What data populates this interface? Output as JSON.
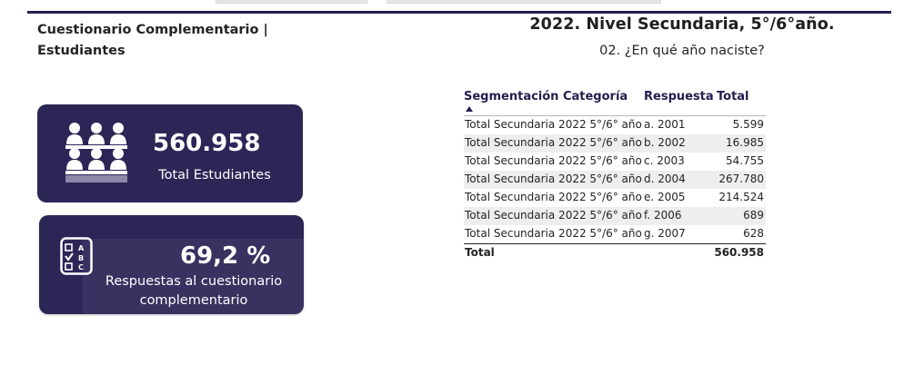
{
  "header": {
    "page_title": "Cuestionario Complementario | Estudiantes",
    "report_title": "2022. Nivel Secundaria, 5°/6°año.",
    "question": "02. ¿En qué año naciste?"
  },
  "cards": {
    "students": {
      "value": "560.958",
      "label": "Total Estudiantes",
      "icon": "students-group-icon"
    },
    "responses": {
      "value": "69,2 %",
      "label": "Respuestas al cuestionario complementario",
      "icon": "quiz-checklist-icon"
    }
  },
  "colors": {
    "card_bg": "#2c2657",
    "accent": "#22204e"
  },
  "table": {
    "columns": [
      "Segmentación Categoría",
      "Respuesta",
      "Total"
    ],
    "sorted_column": "Segmentación Categoría",
    "rows": [
      {
        "categoria": "Total Secundaria 2022 5°/6° año",
        "respuesta": "a. 2001",
        "total": "5.599"
      },
      {
        "categoria": "Total Secundaria 2022 5°/6° año",
        "respuesta": "b. 2002",
        "total": "16.985"
      },
      {
        "categoria": "Total Secundaria 2022 5°/6° año",
        "respuesta": "c. 2003",
        "total": "54.755"
      },
      {
        "categoria": "Total Secundaria 2022 5°/6° año",
        "respuesta": "d. 2004",
        "total": "267.780"
      },
      {
        "categoria": "Total Secundaria 2022 5°/6° año",
        "respuesta": "e. 2005",
        "total": "214.524"
      },
      {
        "categoria": "Total Secundaria 2022 5°/6° año",
        "respuesta": "f. 2006",
        "total": "689"
      },
      {
        "categoria": "Total Secundaria 2022 5°/6° año",
        "respuesta": "g. 2007",
        "total": "628"
      }
    ],
    "total_label": "Total",
    "total_value": "560.958"
  }
}
